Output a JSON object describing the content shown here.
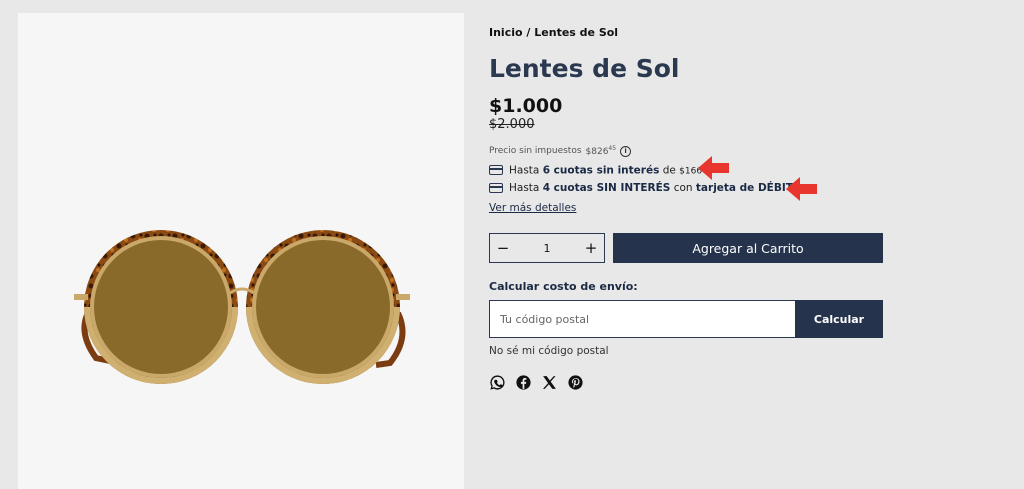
{
  "breadcrumb": {
    "home": "Inicio",
    "separator": "/",
    "current": "Lentes de Sol"
  },
  "product": {
    "title": "Lentes de Sol",
    "price": "$1.000",
    "old_price": "$2.000",
    "tax_label": "Precio sin impuestos",
    "tax_value": "$826",
    "tax_cents": "45",
    "image_icon": "sunglasses-image"
  },
  "installments": [
    {
      "prefix": "Hasta",
      "bold": "6 cuotas sin interés",
      "middle": "de",
      "amount": "$166",
      "cents": "67",
      "icon": "credit-card-icon"
    },
    {
      "prefix": "Hasta",
      "bold": "4 cuotas SIN INTERÉS",
      "middle": "con",
      "bold2": "tarjeta de DÉBITO",
      "icon": "credit-card-icon"
    }
  ],
  "more_details": "Ver más detalles",
  "cart": {
    "minus": "−",
    "quantity": "1",
    "plus": "+",
    "add_label": "Agregar al Carrito"
  },
  "shipping": {
    "label": "Calcular costo de envío:",
    "placeholder": "Tu código postal",
    "calc_label": "Calcular",
    "dont_know": "No sé mi código postal"
  },
  "share_icons": [
    "whatsapp-icon",
    "facebook-icon",
    "x-icon",
    "pinterest-icon"
  ],
  "colors": {
    "primary": "#25344c",
    "accent_arrow": "#e8362f",
    "background": "#e8e8e8"
  }
}
